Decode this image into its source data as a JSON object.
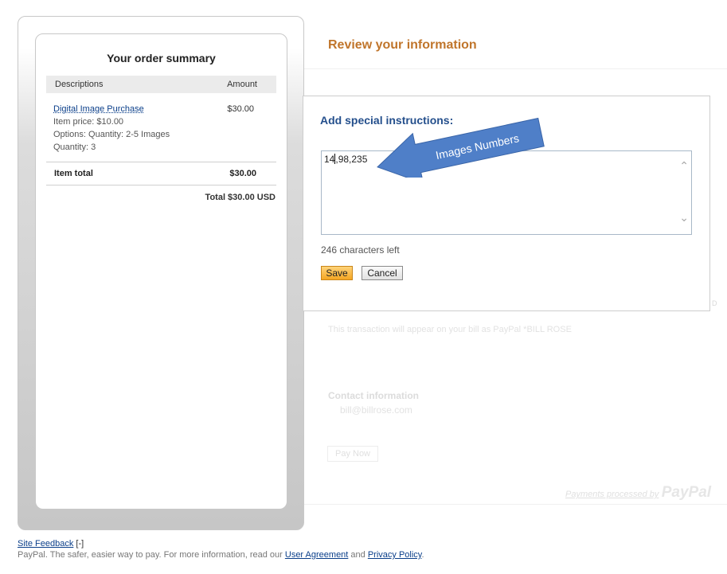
{
  "order_summary": {
    "title": "Your order summary",
    "col_description": "Descriptions",
    "col_amount": "Amount",
    "item": {
      "name": "Digital Image Purchase",
      "amount": "$30.00",
      "price_line": "Item price: $10.00",
      "options_line": "Options: Quantity: 2-5 Images",
      "quantity_line": "Quantity: 3"
    },
    "item_total_label": "Item total",
    "item_total_value": "$30.00",
    "grand_total": "Total $30.00 USD"
  },
  "review": {
    "title": "Review your information",
    "statement_note": "This transaction will appear on your bill as PayPal *BILL ROSE",
    "contact_heading": "Contact information",
    "contact_email": "bill@billrose.com",
    "pay_now": "Pay Now",
    "payments_processed": "Payments processed by",
    "paypal_logo": "PayPal"
  },
  "dialog": {
    "title": "Add special instructions:",
    "textarea_value": "14,98,235",
    "chars_left": "246 characters left",
    "save_label": "Save",
    "cancel_label": "Cancel"
  },
  "annotation": {
    "label": "Images Numbers",
    "color": "#4f7fc8"
  },
  "footer": {
    "site_feedback": "Site Feedback",
    "feedback_toggle": "[-]",
    "tagline": "PayPal. The safer, easier way to pay. For more information, read our",
    "user_agreement": "User Agreement",
    "and": "and",
    "privacy_policy": "Privacy Policy",
    "period": "."
  }
}
